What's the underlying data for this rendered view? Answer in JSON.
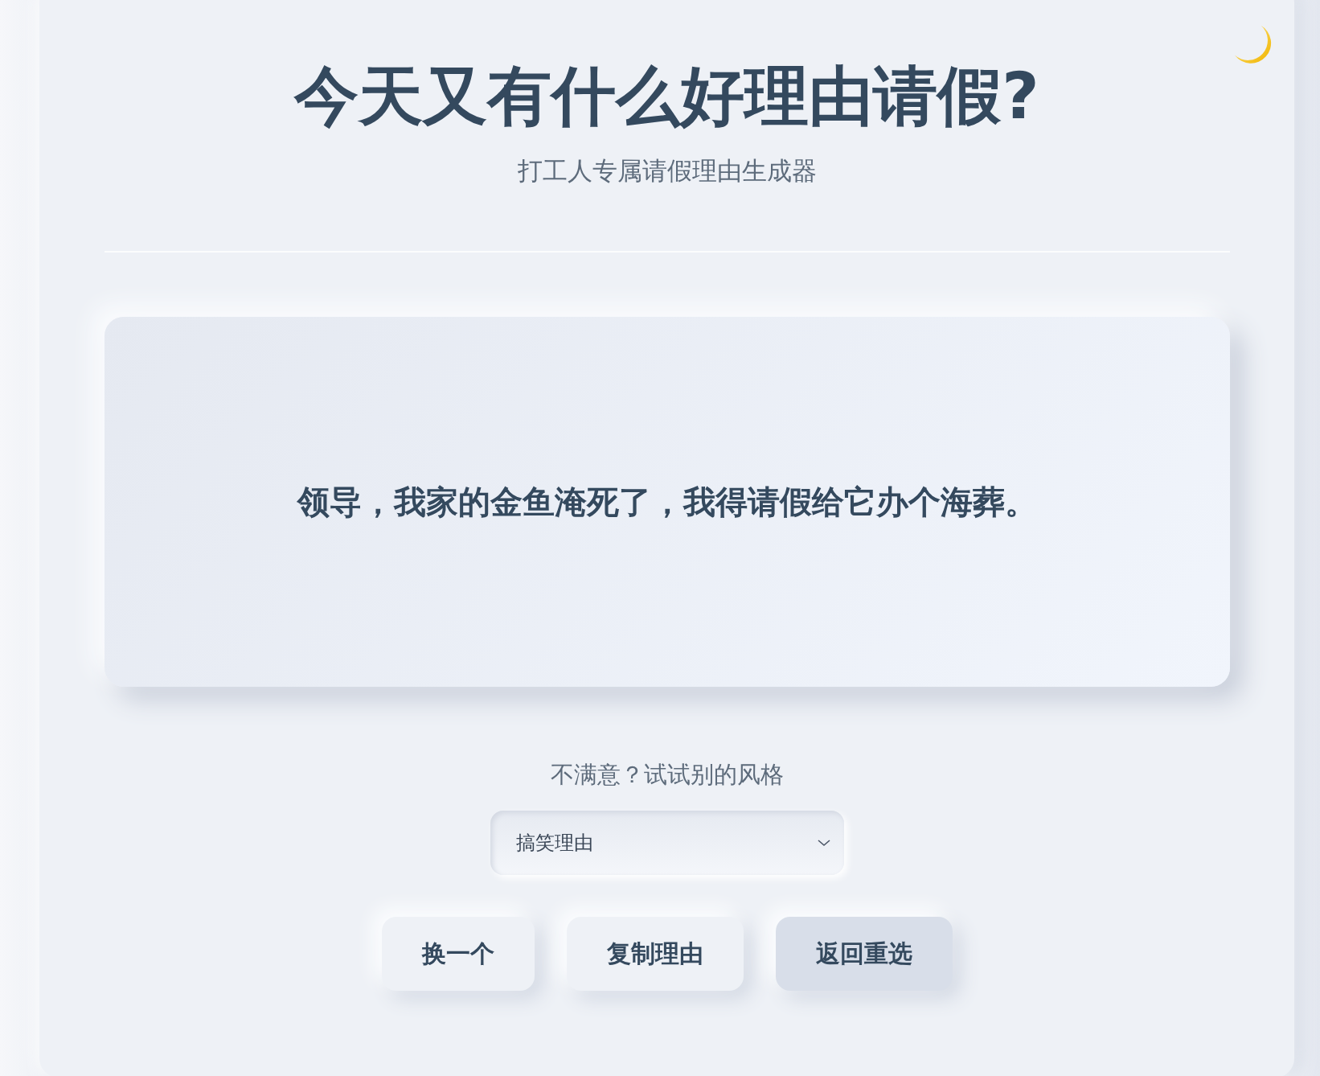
{
  "header": {
    "title": "今天又有什么好理由请假?",
    "subtitle": "打工人专属请假理由生成器"
  },
  "reason": {
    "text": "领导，我家的金鱼淹死了，我得请假给它办个海葬。"
  },
  "style_picker": {
    "prompt": "不满意？试试别的风格",
    "value": "搞笑理由"
  },
  "buttons": [
    {
      "label": "换一个",
      "kind": "default"
    },
    {
      "label": "复制理由",
      "kind": "default"
    },
    {
      "label": "返回重选",
      "kind": "secondary"
    }
  ]
}
